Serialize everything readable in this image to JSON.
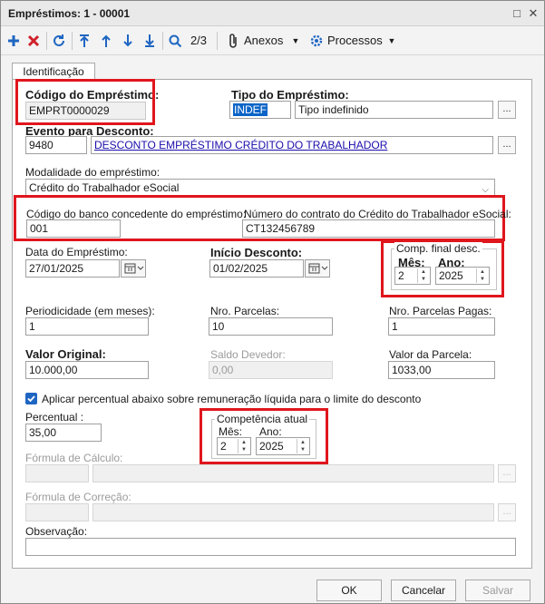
{
  "window": {
    "title": "Empréstimos: 1 - 00001"
  },
  "toolbar": {
    "record_position": "2/3",
    "anexos_label": "Anexos",
    "processos_label": "Processos"
  },
  "tabs": {
    "identificacao": "Identificação"
  },
  "form": {
    "codigo_emprestimo": {
      "label": "Código do Empréstimo:",
      "value": "EMPRT0000029"
    },
    "tipo_emprestimo": {
      "label": "Tipo do Empréstimo:",
      "code": "INDEF",
      "description": "Tipo indefinido"
    },
    "evento_desconto": {
      "label": "Evento para Desconto:",
      "code": "9480",
      "description": "DESCONTO EMPRÉSTIMO CRÉDITO DO TRABALHADOR"
    },
    "modalidade": {
      "label": "Modalidade do empréstimo:",
      "value": "Crédito do Trabalhador eSocial"
    },
    "codigo_banco": {
      "label": "Código do banco concedente do empréstimo:",
      "value": "001"
    },
    "numero_contrato": {
      "label": "Número do contrato do Crédito do Trabalhador eSocial:",
      "value": "CT132456789"
    },
    "data_emprestimo": {
      "label": "Data do Empréstimo:",
      "value": "27/01/2025"
    },
    "inicio_desconto": {
      "label": "Início Desconto:",
      "value": "01/02/2025"
    },
    "comp_final": {
      "legend": "Comp. final desc.",
      "mes_label": "Mês:",
      "mes_value": "2",
      "ano_label": "Ano:",
      "ano_value": "2025"
    },
    "periodicidade": {
      "label": "Periodicidade (em meses):",
      "value": "1"
    },
    "nro_parcelas": {
      "label": "Nro. Parcelas:",
      "value": "10"
    },
    "nro_parcelas_pagas": {
      "label": "Nro. Parcelas Pagas:",
      "value": "1"
    },
    "valor_original": {
      "label": "Valor Original:",
      "value": "10.000,00"
    },
    "saldo_devedor": {
      "label": "Saldo Devedor:",
      "value": "0,00"
    },
    "valor_parcela": {
      "label": "Valor da Parcela:",
      "value": "1033,00"
    },
    "aplicar_percentual": {
      "label": "Aplicar percentual abaixo sobre remuneração líquida para o limite do desconto"
    },
    "percentual": {
      "label": "Percentual :",
      "value": "35,00"
    },
    "competencia_atual": {
      "legend": "Competência atual",
      "mes_label": "Mês:",
      "mes_value": "2",
      "ano_label": "Ano:",
      "ano_value": "2025"
    },
    "formula_calculo": {
      "label": "Fórmula de Cálculo:"
    },
    "formula_correcao": {
      "label": "Fórmula de Correção:"
    },
    "observacao": {
      "label": "Observação:"
    }
  },
  "buttons": {
    "ok": "OK",
    "cancelar": "Cancelar",
    "salvar": "Salvar",
    "ellipsis": "..."
  },
  "colors": {
    "highlight_red": "#e0161d",
    "selection_blue": "#0a64c8",
    "link_blue": "#1a0dab",
    "add_blue": "#1f66c2",
    "delete_red": "#d0202a"
  }
}
